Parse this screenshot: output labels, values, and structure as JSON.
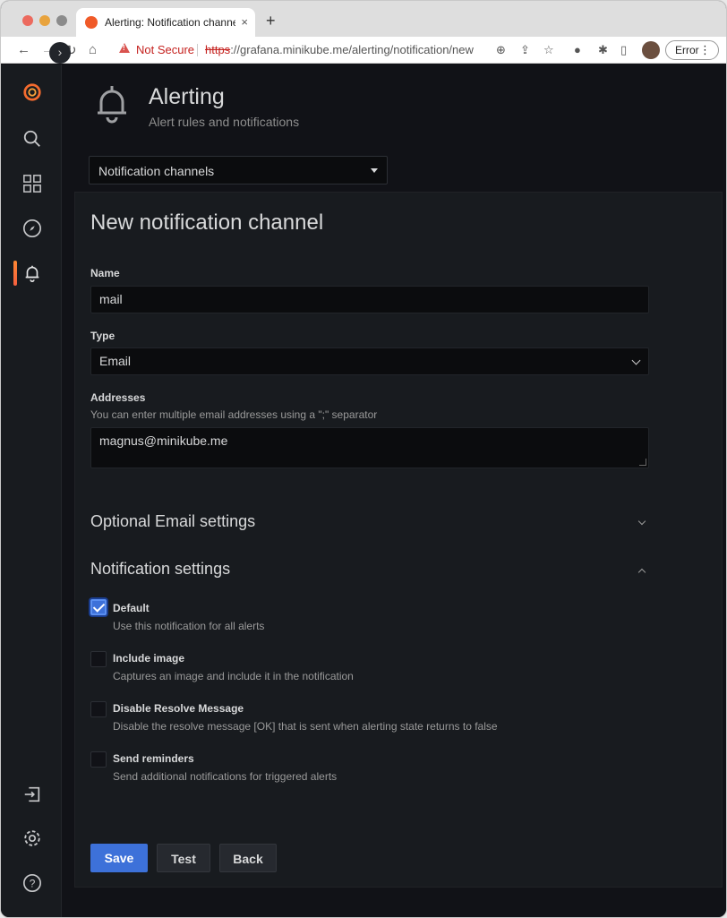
{
  "browser": {
    "tab_title": "Alerting: Notification channels",
    "tab_close": "×",
    "new_tab": "+",
    "not_secure": "Not Secure",
    "url_scheme": "https",
    "url_rest": "://grafana.minikube.me/alerting/notification/new",
    "error_label": "Error",
    "error_menu": "⋮"
  },
  "header": {
    "title": "Alerting",
    "subtitle": "Alert rules and notifications",
    "nav_select": "Notification channels"
  },
  "form": {
    "heading": "New notification channel",
    "name_label": "Name",
    "name_value": "mail",
    "type_label": "Type",
    "type_value": "Email",
    "addresses_label": "Addresses",
    "addresses_desc": "You can enter multiple email addresses using a \";\" separator",
    "addresses_value": "magnus@minikube.me"
  },
  "sections": {
    "optional": "Optional Email settings",
    "notification": "Notification settings"
  },
  "options": [
    {
      "label": "Default",
      "desc": "Use this notification for all alerts",
      "checked": true
    },
    {
      "label": "Include image",
      "desc": "Captures an image and include it in the notification",
      "checked": false
    },
    {
      "label": "Disable Resolve Message",
      "desc": "Disable the resolve message [OK] that is sent when alerting state returns to false",
      "checked": false
    },
    {
      "label": "Send reminders",
      "desc": "Send additional notifications for triggered alerts",
      "checked": false
    }
  ],
  "buttons": {
    "save": "Save",
    "test": "Test",
    "back": "Back"
  },
  "colors": {
    "accent": "#3d71d9",
    "brand": "#f05a28",
    "background": "#111217",
    "panel": "#181b1f"
  }
}
